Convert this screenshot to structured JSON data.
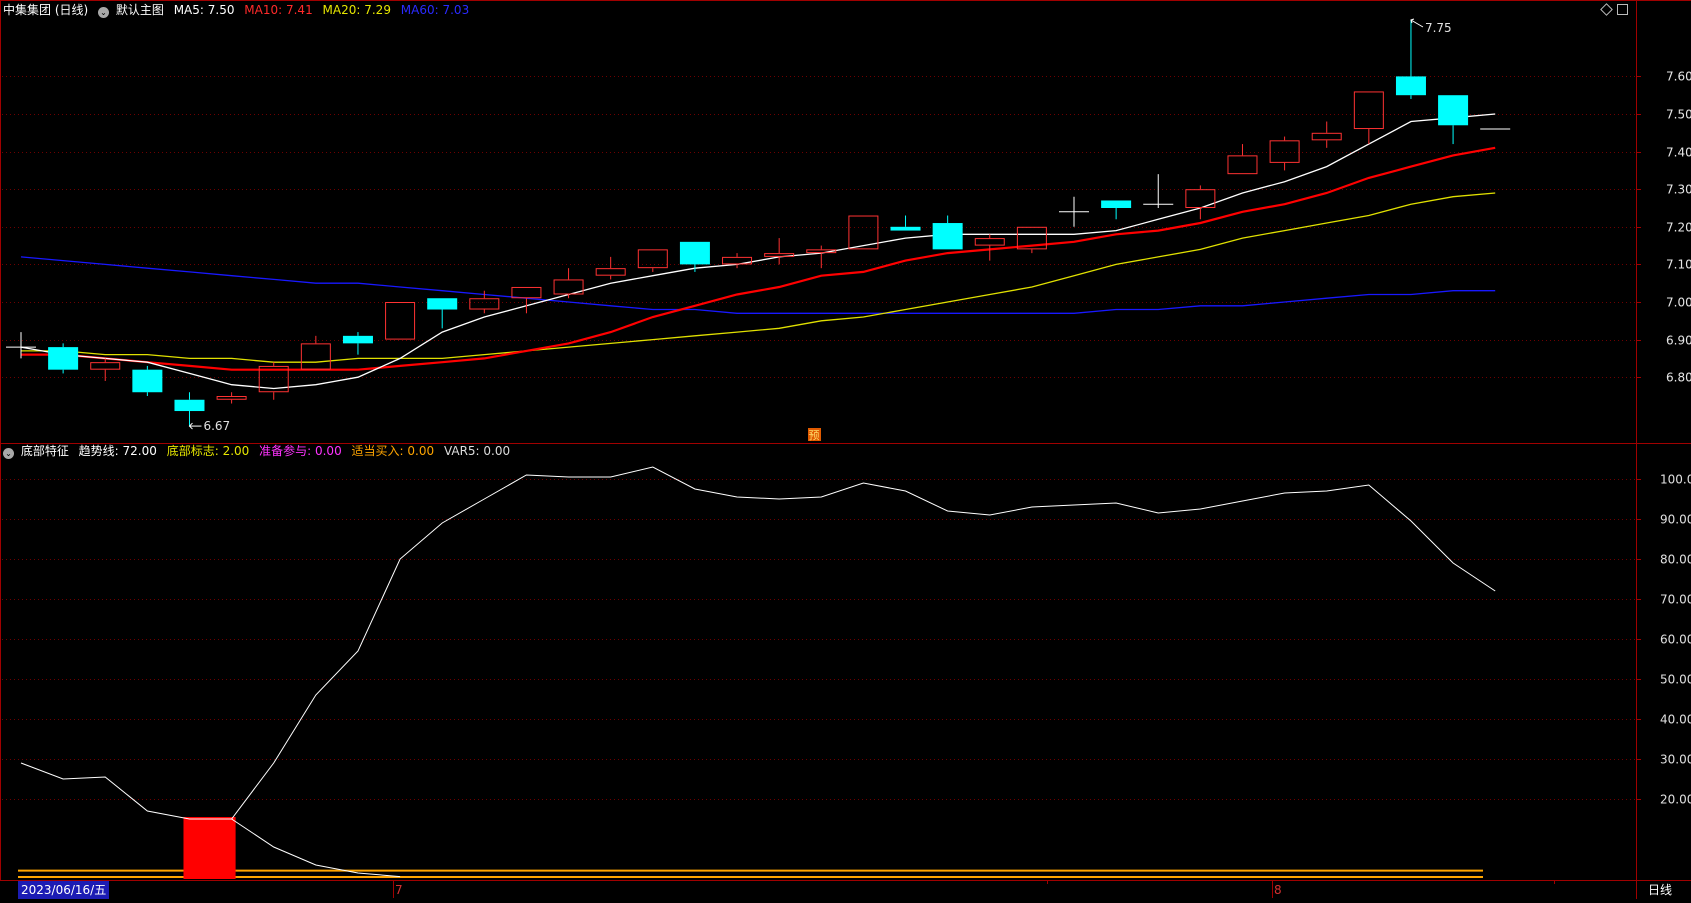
{
  "main_header": {
    "stock_name": "中集集团 (日线)",
    "template_icon": "circle-chevron-icon",
    "template_label": "默认主图",
    "ma5": "MA5: 7.50",
    "ma10": "MA10: 7.41",
    "ma20": "MA20: 7.29",
    "ma60": "MA60: 7.03"
  },
  "sub_header": {
    "indicator_icon": "circle-chevron-icon",
    "indicator_name": "底部特征",
    "trend": "趋势线: 72.00",
    "bottom_flag": "底部标志: 2.00",
    "prepare": "准备参与: 0.00",
    "buy": "适当买入: 0.00",
    "var5": "VAR5: 0.00"
  },
  "annotations": {
    "high": "7.75",
    "low": "6.67",
    "forecast_badge": "预"
  },
  "bottom_bar": {
    "date_cursor": "2023/06/16/五",
    "month_7": "7",
    "month_8": "8",
    "period_button": "日线"
  },
  "colors": {
    "background": "#000000",
    "grid": "#6e0000",
    "frame": "#a00000",
    "up": "#ff3232",
    "down": "#00ffff",
    "ma5": "#ffffff",
    "ma10": "#ff0000",
    "ma20": "#e0e000",
    "ma60": "#1818ff",
    "trend_line": "#ffffff",
    "bottom_flag_bar": "#ff0000",
    "ref_line": "#ffa500"
  },
  "chart_data": [
    {
      "type": "candlestick",
      "title": "中集集团 (日线)",
      "y_ticks": [
        6.8,
        6.9,
        7.0,
        7.1,
        7.2,
        7.3,
        7.4,
        7.5,
        7.6
      ],
      "y_tick_labels": [
        "6.80",
        "6.90",
        "7.00",
        "7.10",
        "7.20",
        "7.30",
        "7.40",
        "7.50",
        "7.60"
      ],
      "ylim": [
        6.6,
        7.8
      ],
      "candles": [
        {
          "o": 6.88,
          "h": 6.92,
          "l": 6.85,
          "c": 6.88
        },
        {
          "o": 6.88,
          "h": 6.89,
          "l": 6.81,
          "c": 6.82
        },
        {
          "o": 6.82,
          "h": 6.85,
          "l": 6.79,
          "c": 6.84
        },
        {
          "o": 6.82,
          "h": 6.83,
          "l": 6.75,
          "c": 6.76
        },
        {
          "o": 6.74,
          "h": 6.76,
          "l": 6.67,
          "c": 6.71
        },
        {
          "o": 6.74,
          "h": 6.76,
          "l": 6.73,
          "c": 6.75
        },
        {
          "o": 6.76,
          "h": 6.84,
          "l": 6.74,
          "c": 6.83
        },
        {
          "o": 6.82,
          "h": 6.91,
          "l": 6.82,
          "c": 6.89
        },
        {
          "o": 6.91,
          "h": 6.92,
          "l": 6.86,
          "c": 6.89
        },
        {
          "o": 6.9,
          "h": 7.0,
          "l": 6.9,
          "c": 7.0
        },
        {
          "o": 7.01,
          "h": 7.01,
          "l": 6.93,
          "c": 6.98
        },
        {
          "o": 6.98,
          "h": 7.03,
          "l": 6.97,
          "c": 7.01
        },
        {
          "o": 7.01,
          "h": 7.04,
          "l": 6.97,
          "c": 7.04
        },
        {
          "o": 7.02,
          "h": 7.09,
          "l": 7.01,
          "c": 7.06
        },
        {
          "o": 7.07,
          "h": 7.12,
          "l": 7.06,
          "c": 7.09
        },
        {
          "o": 7.09,
          "h": 7.14,
          "l": 7.08,
          "c": 7.14
        },
        {
          "o": 7.16,
          "h": 7.16,
          "l": 7.08,
          "c": 7.1
        },
        {
          "o": 7.1,
          "h": 7.13,
          "l": 7.09,
          "c": 7.12
        },
        {
          "o": 7.12,
          "h": 7.17,
          "l": 7.1,
          "c": 7.13
        },
        {
          "o": 7.13,
          "h": 7.15,
          "l": 7.09,
          "c": 7.14
        },
        {
          "o": 7.14,
          "h": 7.23,
          "l": 7.14,
          "c": 7.23
        },
        {
          "o": 7.2,
          "h": 7.23,
          "l": 7.19,
          "c": 7.19
        },
        {
          "o": 7.21,
          "h": 7.23,
          "l": 7.14,
          "c": 7.14
        },
        {
          "o": 7.15,
          "h": 7.18,
          "l": 7.11,
          "c": 7.17
        },
        {
          "o": 7.14,
          "h": 7.2,
          "l": 7.13,
          "c": 7.2
        },
        {
          "o": 7.24,
          "h": 7.28,
          "l": 7.2,
          "c": 7.24
        },
        {
          "o": 7.27,
          "h": 7.27,
          "l": 7.22,
          "c": 7.25
        },
        {
          "o": 7.26,
          "h": 7.34,
          "l": 7.25,
          "c": 7.26
        },
        {
          "o": 7.25,
          "h": 7.31,
          "l": 7.22,
          "c": 7.3
        },
        {
          "o": 7.34,
          "h": 7.42,
          "l": 7.34,
          "c": 7.39
        },
        {
          "o": 7.37,
          "h": 7.44,
          "l": 7.35,
          "c": 7.43
        },
        {
          "o": 7.43,
          "h": 7.48,
          "l": 7.41,
          "c": 7.45
        },
        {
          "o": 7.46,
          "h": 7.56,
          "l": 7.42,
          "c": 7.56
        },
        {
          "o": 7.6,
          "h": 7.75,
          "l": 7.54,
          "c": 7.55
        },
        {
          "o": 7.55,
          "h": 7.55,
          "l": 7.42,
          "c": 7.47
        },
        {
          "o": 7.46,
          "h": 7.46,
          "l": 7.46,
          "c": 7.46
        }
      ],
      "ma5": [
        6.88,
        6.86,
        6.85,
        6.84,
        6.81,
        6.78,
        6.77,
        6.78,
        6.8,
        6.85,
        6.92,
        6.96,
        6.99,
        7.02,
        7.05,
        7.07,
        7.09,
        7.1,
        7.12,
        7.13,
        7.15,
        7.17,
        7.18,
        7.18,
        7.18,
        7.18,
        7.19,
        7.22,
        7.25,
        7.29,
        7.32,
        7.36,
        7.42,
        7.48,
        7.49,
        7.5
      ],
      "ma10": [
        6.86,
        6.86,
        6.85,
        6.84,
        6.83,
        6.82,
        6.82,
        6.82,
        6.82,
        6.83,
        6.84,
        6.85,
        6.87,
        6.89,
        6.92,
        6.96,
        6.99,
        7.02,
        7.04,
        7.07,
        7.08,
        7.11,
        7.13,
        7.14,
        7.15,
        7.16,
        7.18,
        7.19,
        7.21,
        7.24,
        7.26,
        7.29,
        7.33,
        7.36,
        7.39,
        7.41
      ],
      "ma20": [
        6.87,
        6.87,
        6.86,
        6.86,
        6.85,
        6.85,
        6.84,
        6.84,
        6.85,
        6.85,
        6.85,
        6.86,
        6.87,
        6.88,
        6.89,
        6.9,
        6.91,
        6.92,
        6.93,
        6.95,
        6.96,
        6.98,
        7.0,
        7.02,
        7.04,
        7.07,
        7.1,
        7.12,
        7.14,
        7.17,
        7.19,
        7.21,
        7.23,
        7.26,
        7.28,
        7.29
      ],
      "ma60": [
        7.12,
        7.11,
        7.1,
        7.09,
        7.08,
        7.07,
        7.06,
        7.05,
        7.05,
        7.04,
        7.03,
        7.02,
        7.01,
        7.0,
        6.99,
        6.98,
        6.98,
        6.97,
        6.97,
        6.97,
        6.97,
        6.97,
        6.97,
        6.97,
        6.97,
        6.97,
        6.98,
        6.98,
        6.99,
        6.99,
        7.0,
        7.01,
        7.02,
        7.02,
        7.03,
        7.03
      ]
    },
    {
      "type": "line",
      "title": "底部特征",
      "y_ticks": [
        20,
        30,
        40,
        50,
        60,
        70,
        80,
        90,
        100
      ],
      "y_tick_labels": [
        "20.00",
        "30.00",
        "40.00",
        "50.00",
        "60.00",
        "70.00",
        "80.00",
        "90.00",
        "100.00"
      ],
      "ylim": [
        0,
        106
      ],
      "series": [
        {
          "name": "趋势线",
          "values": [
            29,
            25,
            25.5,
            17,
            15,
            15,
            29,
            46,
            57,
            80,
            89,
            95,
            101,
            100.5,
            100.5,
            103,
            97.5,
            95.5,
            95,
            95.5,
            99,
            97,
            92,
            91,
            93,
            93.5,
            94,
            91.5,
            92.5,
            94.5,
            96.5,
            97,
            98.5,
            89.5,
            79,
            72
          ]
        },
        {
          "name": "底部标志",
          "values": [
            0,
            0,
            0,
            0,
            2,
            2,
            0,
            0,
            0,
            0,
            0,
            0,
            0,
            0,
            0,
            0,
            0,
            0,
            0,
            0,
            0,
            0,
            0,
            0,
            0,
            0,
            0,
            0,
            0,
            0,
            0,
            0,
            0,
            0,
            0,
            2
          ]
        }
      ],
      "bottom_flag_bar": {
        "from_index": 4,
        "to_index": 5,
        "top_value": 15.5
      },
      "ref_levels": [
        2.1,
        0.5
      ]
    }
  ]
}
